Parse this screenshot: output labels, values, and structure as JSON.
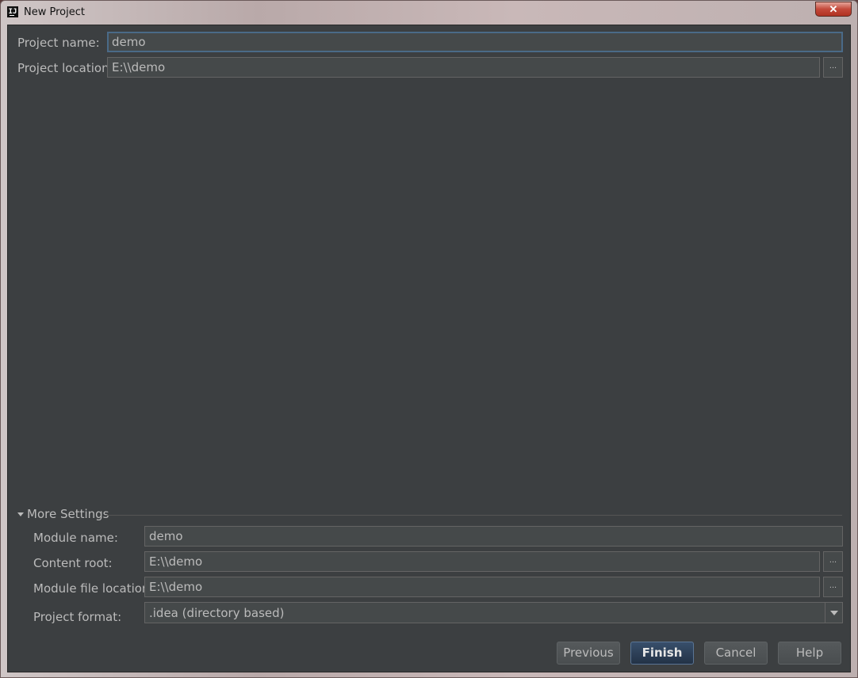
{
  "window": {
    "title": "New Project",
    "close_glyph": "✕",
    "app_icon_text": "IJ"
  },
  "form": {
    "project_name_label": "Project name:",
    "project_name_value": "demo",
    "project_location_label": "Project location:",
    "project_location_value": "E:\\\\demo",
    "browse_glyph": "..."
  },
  "more_settings": {
    "title": "More Settings",
    "module_name_label": "Module name:",
    "module_name_value": "demo",
    "content_root_label": "Content root:",
    "content_root_value": "E:\\\\demo",
    "module_file_location_label": "Module file location:",
    "module_file_location_value": "E:\\\\demo",
    "project_format_label": "Project format:",
    "project_format_value": ".idea (directory based)"
  },
  "buttons": {
    "previous": "Previous",
    "finish": "Finish",
    "cancel": "Cancel",
    "help": "Help"
  },
  "colors": {
    "background": "#3c3f41",
    "field": "#45494a",
    "text": "#bbbbbb",
    "focus": "#4a6a88",
    "default_button": "#2b3e55"
  },
  "icons": {
    "app": "intellij-logo-icon",
    "close": "close-icon",
    "browse": "ellipsis-icon",
    "expand": "triangle-down-icon",
    "dropdown": "chevron-down-icon"
  }
}
